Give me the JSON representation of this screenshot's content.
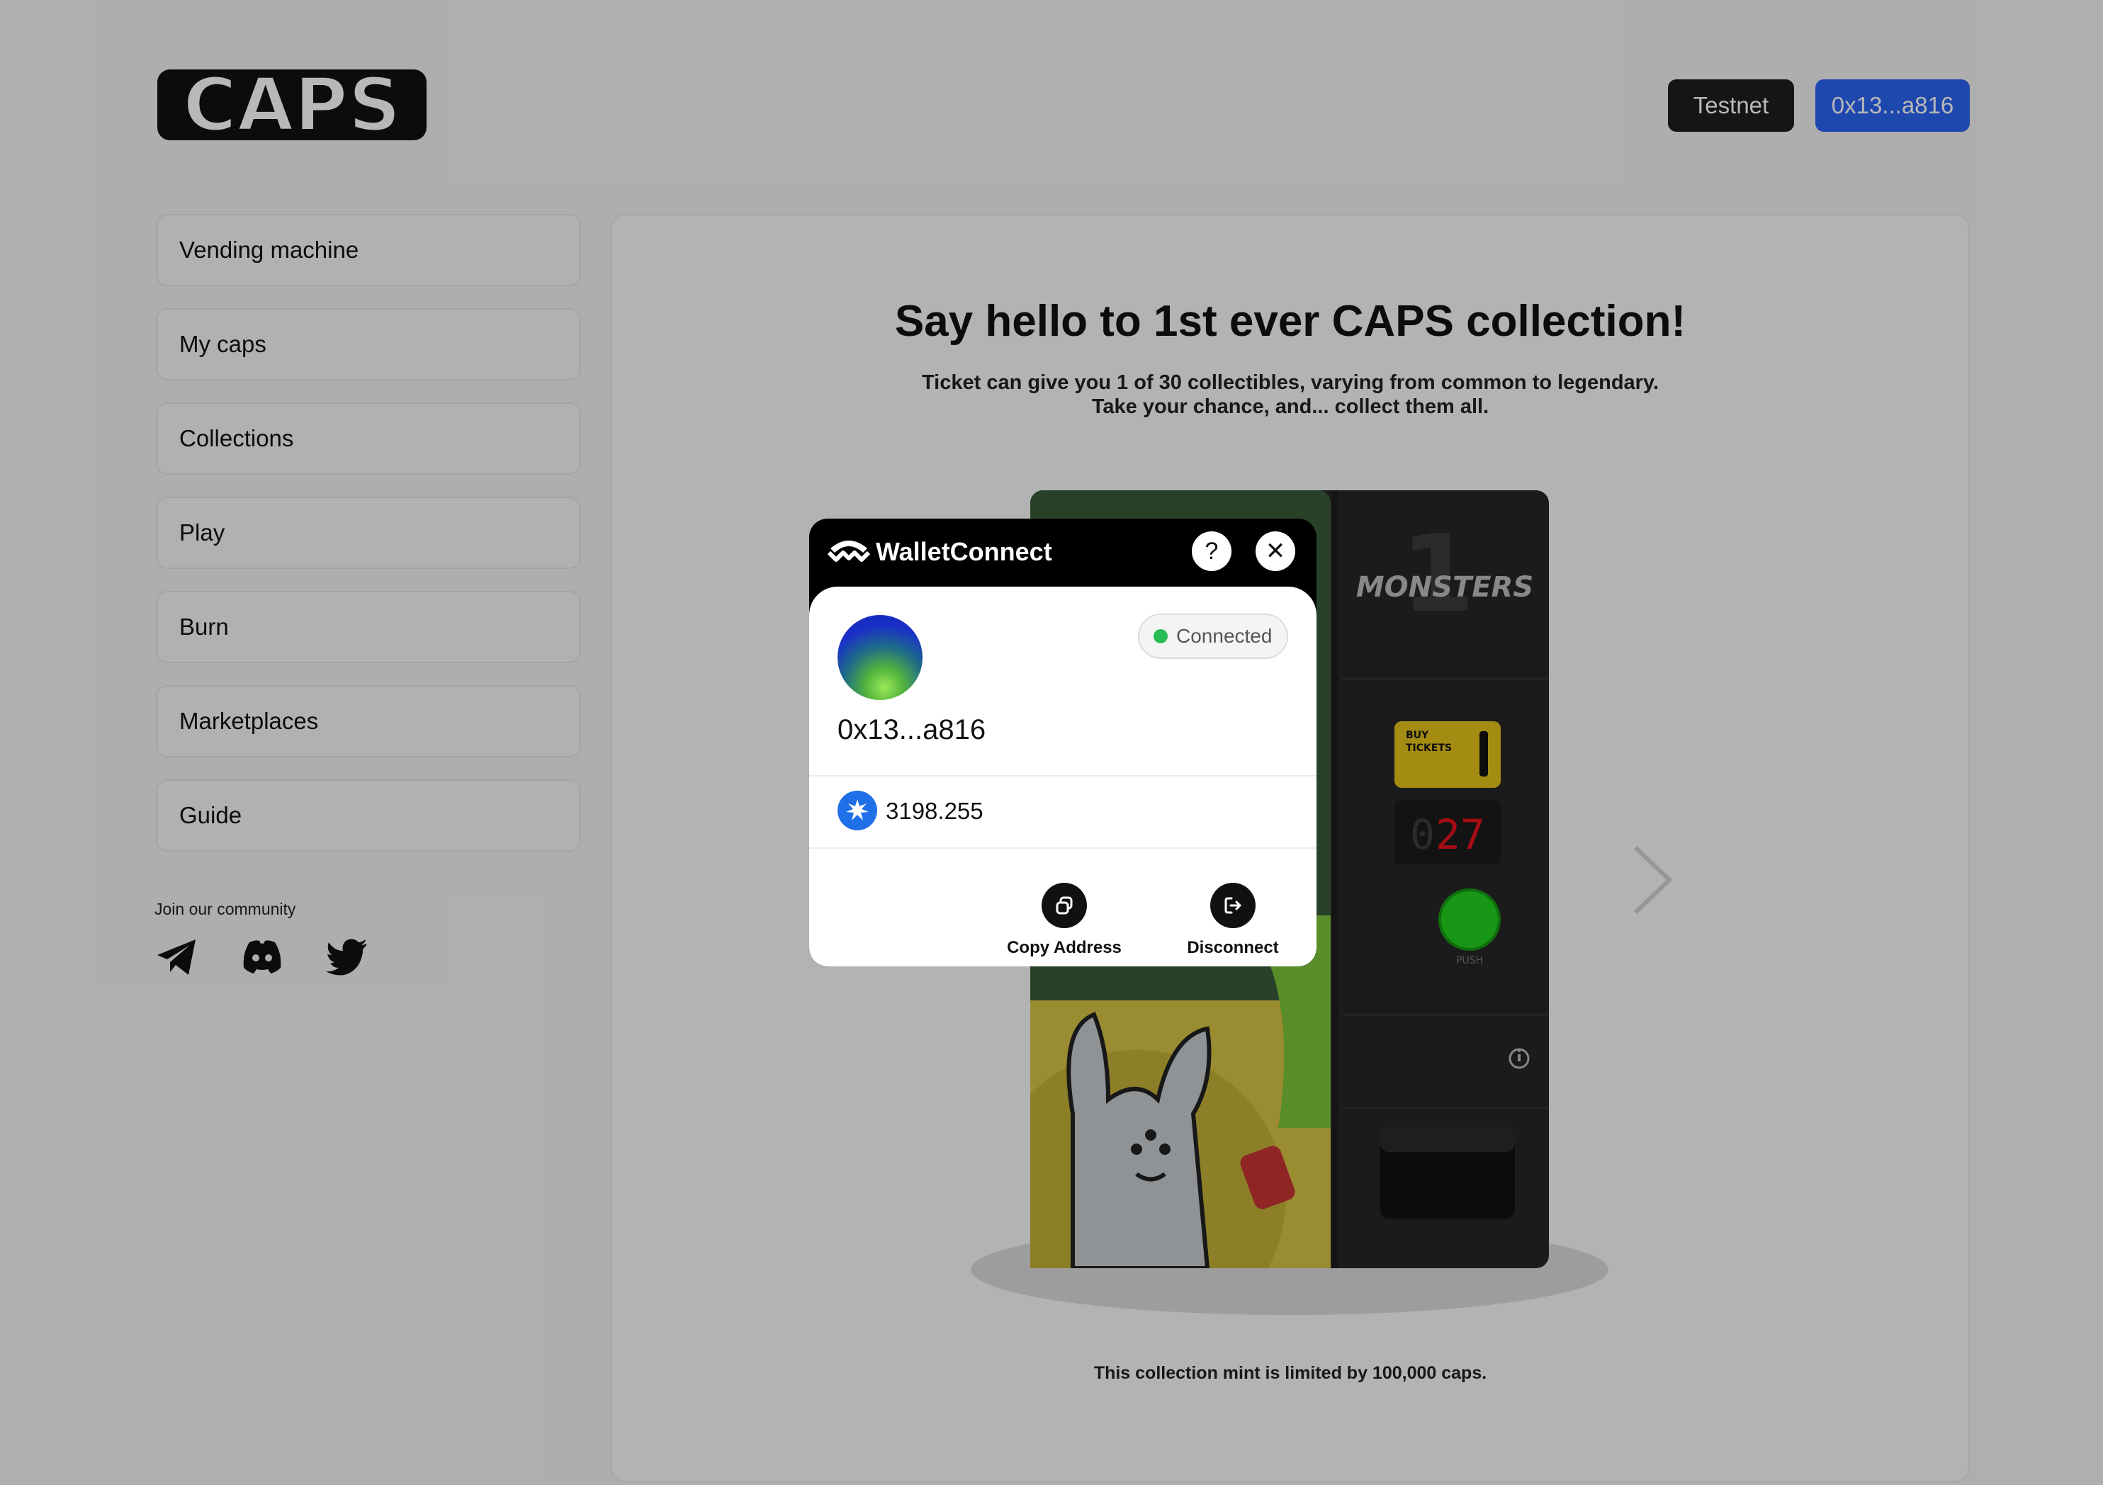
{
  "app": {
    "logo_text": "CAPS"
  },
  "header": {
    "network_label": "Testnet",
    "wallet_label": "0x13...a816"
  },
  "sidebar": {
    "items": [
      {
        "label": "Vending machine"
      },
      {
        "label": "My caps"
      },
      {
        "label": "Collections"
      },
      {
        "label": "Play"
      },
      {
        "label": "Burn"
      },
      {
        "label": "Marketplaces"
      },
      {
        "label": "Guide"
      }
    ],
    "community_label": "Join our community",
    "socials": [
      "telegram-icon",
      "discord-icon",
      "twitter-icon"
    ]
  },
  "main": {
    "headline": "Say hello to 1st ever CAPS collection!",
    "subtitle_line1": "Ticket can give you 1 of 30 collectibles, varying from common to legendary.",
    "subtitle_line2": "Take your chance, and... collect them all.",
    "limit_text": "This collection mint is limited by 100,000 caps."
  },
  "vending_machine": {
    "brand": "MONSTERS",
    "brand_number": "1",
    "ticket_label_1": "BUY",
    "ticket_label_2": "TICKETS",
    "counter_dim": "0",
    "counter_lit": "27",
    "push_label": "PUSH"
  },
  "modal": {
    "title": "WalletConnect",
    "help_glyph": "?",
    "close_glyph": "✕",
    "status": "Connected",
    "address": "0x13...a816",
    "balance": "3198.255",
    "copy_label": "Copy Address",
    "disconnect_label": "Disconnect"
  },
  "colors": {
    "accent_blue": "#2c64f1",
    "status_green": "#2bbd55",
    "machine_dark": "#262626",
    "counter_red": "#e5131b"
  }
}
